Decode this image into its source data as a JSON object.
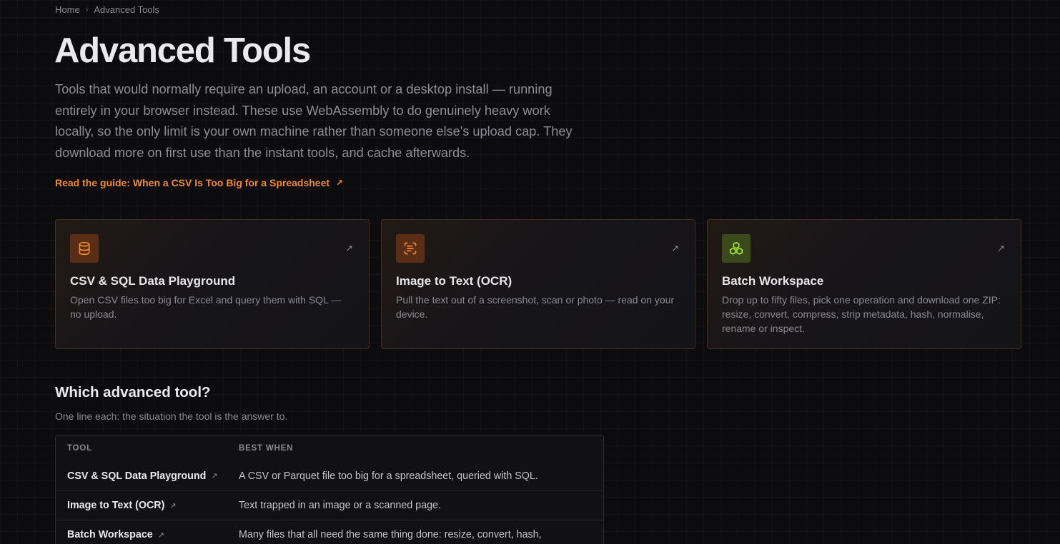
{
  "breadcrumb": {
    "home": "Home",
    "separator": "›",
    "current": "Advanced Tools"
  },
  "header": {
    "title": "Advanced Tools",
    "intro": "Tools that would normally require an upload, an account or a desktop install — running entirely in your browser instead. These use WebAssembly to do genuinely heavy work locally, so the only limit is your own machine rather than someone else's upload cap. They download more on first use than the instant tools, and cache afterwards.",
    "guide_link": "Read the guide: When a CSV Is Too Big for a Spreadsheet",
    "guide_arrow": "↗"
  },
  "cards": [
    {
      "icon": "database-icon",
      "title": "CSV & SQL Data Playground",
      "description": "Open CSV files too big for Excel and query them with SQL — no upload.",
      "arrow": "↗",
      "accent": "#f08a2c"
    },
    {
      "icon": "scan-text-icon",
      "title": "Image to Text (OCR)",
      "description": "Pull the text out of a screenshot, scan or photo — read on your device.",
      "arrow": "↗",
      "accent": "#f08a2c"
    },
    {
      "icon": "boxes-icon",
      "title": "Batch Workspace",
      "description": "Drop up to fifty files, pick one operation and download one ZIP: resize, convert, compress, strip metadata, hash, normalise, rename or inspect.",
      "arrow": "↗",
      "accent": "#a3e635"
    }
  ],
  "which": {
    "title": "Which advanced tool?",
    "subtitle": "One line each: the situation the tool is the answer to.",
    "columns": [
      "TOOL",
      "BEST WHEN"
    ],
    "rows": [
      {
        "tool": "CSV & SQL Data Playground",
        "best_when": "A CSV or Parquet file too big for a spreadsheet, queried with SQL."
      },
      {
        "tool": "Image to Text (OCR)",
        "best_when": "Text trapped in an image or a scanned page."
      },
      {
        "tool": "Batch Workspace",
        "best_when": "Many files that all need the same thing done: resize, convert, hash,"
      }
    ],
    "row_arrow": "↗"
  }
}
